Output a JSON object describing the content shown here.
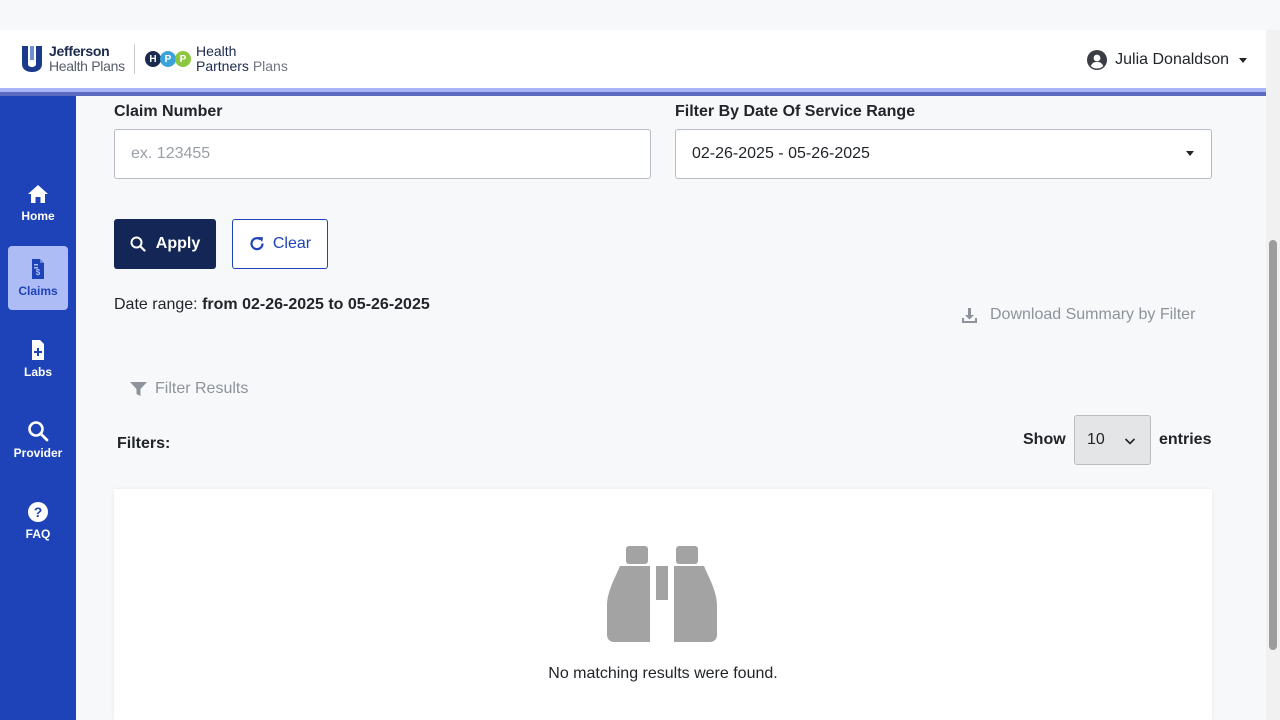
{
  "header": {
    "logo_jefferson_line1": "Jefferson",
    "logo_jefferson_line2": "Health Plans",
    "logo_hpp_letters": [
      "H",
      "P",
      "P"
    ],
    "logo_hpp_line1": "Health",
    "logo_hpp_line2a": "Partners",
    "logo_hpp_line2b": "Plans",
    "user_name": "Julia Donaldson"
  },
  "sidebar": {
    "items": [
      {
        "label": "Home",
        "icon": "home-icon",
        "active": false
      },
      {
        "label": "Claims",
        "icon": "claims-document-icon",
        "active": true
      },
      {
        "label": "Labs",
        "icon": "labs-file-plus-icon",
        "active": false
      },
      {
        "label": "Provider",
        "icon": "search-icon",
        "active": false
      },
      {
        "label": "FAQ",
        "icon": "question-circle-icon",
        "active": false
      }
    ]
  },
  "filters_form": {
    "claim_number_label": "Claim Number",
    "claim_number_placeholder": "ex. 123455",
    "claim_number_value": "",
    "date_filter_label": "Filter By Date Of Service Range",
    "date_filter_value": "02-26-2025 - 05-26-2025",
    "apply_label": "Apply",
    "clear_label": "Clear"
  },
  "summary": {
    "date_range_prefix": "Date range:",
    "date_range_value": "from 02-26-2025 to 05-26-2025",
    "download_label": "Download Summary by Filter",
    "filter_results_label": "Filter Results",
    "filters_label": "Filters:"
  },
  "pagination": {
    "show_label": "Show",
    "entries_value": "10",
    "entries_label": "entries"
  },
  "results": {
    "empty_message": "No matching results were found."
  },
  "colors": {
    "sidebar_bg": "#1e43b8",
    "sidebar_active_bg": "#aebcf6",
    "primary_button": "#132656",
    "accent_border": "#1e43b8",
    "muted_text": "#8e939b"
  }
}
